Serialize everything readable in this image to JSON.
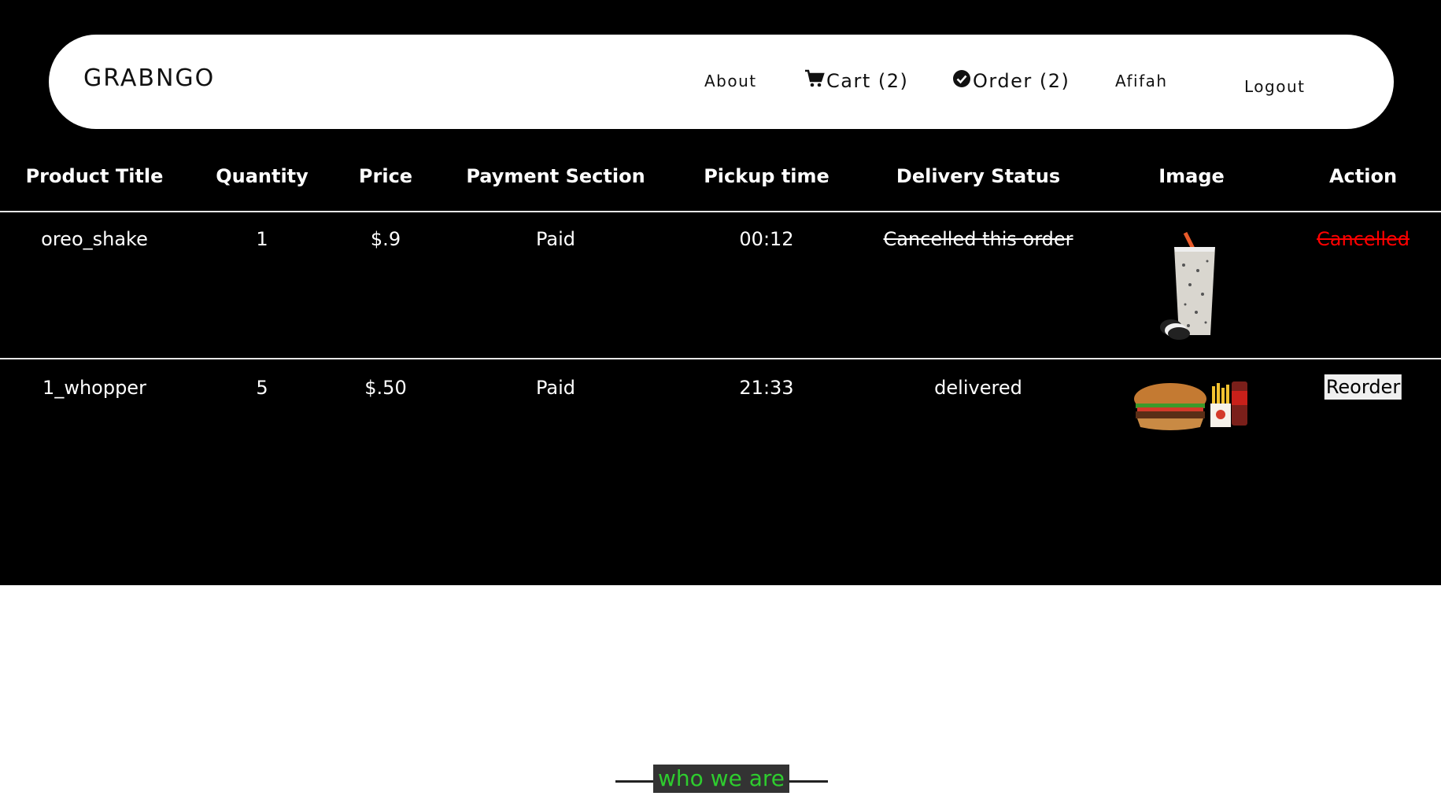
{
  "nav": {
    "brand": "GRABNGO",
    "about": "About",
    "cart": "Cart (2)",
    "order": "Order (2)",
    "user": "Afifah",
    "logout": "Logout"
  },
  "table": {
    "headers": [
      "Product Title",
      "Quantity",
      "Price",
      "Payment Section",
      "Pickup time",
      "Delivery Status",
      "Image",
      "Action"
    ],
    "rows": [
      {
        "title": "oreo_shake",
        "quantity": "1",
        "price": "$.9",
        "payment": "Paid",
        "pickup": "00:12",
        "status": "Cancelled this order",
        "image": "milkshake-image",
        "action": "Cancelled"
      },
      {
        "title": "1_whopper",
        "quantity": "5",
        "price": "$.50",
        "payment": "Paid",
        "pickup": "21:33",
        "status": "delivered",
        "image": "burger-meal-image",
        "action": "Reorder"
      }
    ]
  },
  "footer": {
    "section_title": "who we are"
  },
  "colors": {
    "background": "#000000",
    "cancelled": "#ff0000",
    "accent_green": "#2ecc2e"
  }
}
